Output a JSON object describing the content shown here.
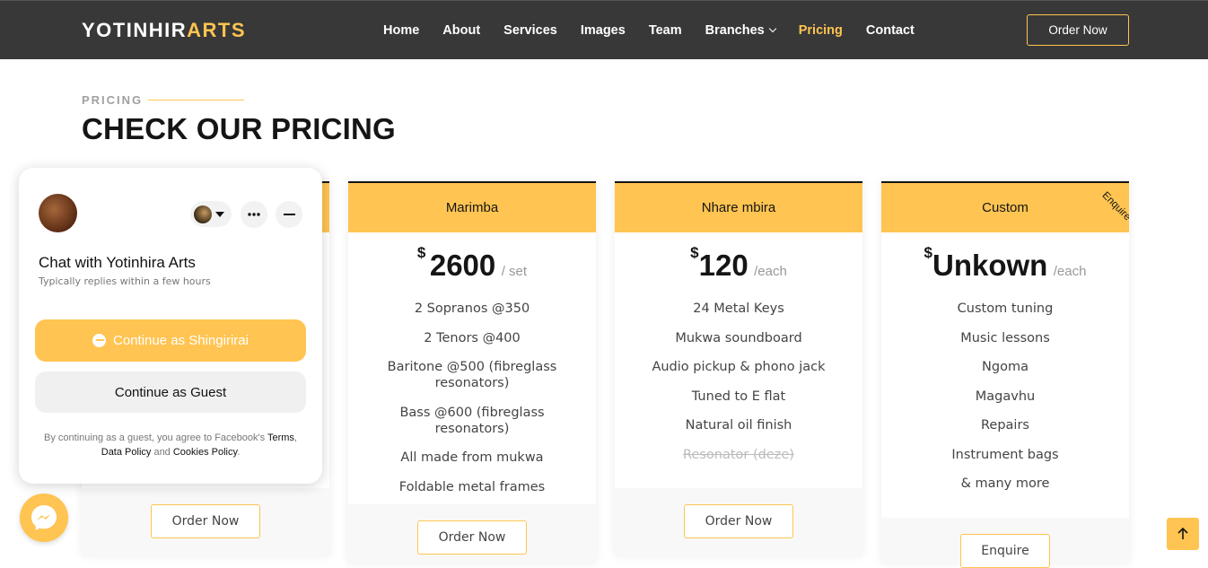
{
  "header": {
    "logo_main": "YOTINHIR",
    "logo_accent": "ARTS",
    "nav": [
      {
        "label": "Home"
      },
      {
        "label": "About"
      },
      {
        "label": "Services"
      },
      {
        "label": "Images"
      },
      {
        "label": "Team"
      },
      {
        "label": "Branches"
      },
      {
        "label": "Pricing"
      },
      {
        "label": "Contact"
      }
    ],
    "active_nav": "Pricing",
    "order_label": "Order Now"
  },
  "section": {
    "label": "PRICING",
    "title": "CHECK OUR PRICING"
  },
  "cards": [
    {
      "name": "",
      "button": "Order Now"
    },
    {
      "name": "Marimba",
      "currency": "$",
      "price": "2600",
      "unit": "/ set",
      "features": [
        "2 Sopranos @350",
        "2 Tenors @400",
        "Baritone @500 (fibreglass resonators)",
        "Bass @600 (fibreglass resonators)",
        "All made from mukwa",
        "Foldable metal frames"
      ],
      "button": "Order Now"
    },
    {
      "name": "Nhare mbira",
      "currency": "$",
      "price": "120",
      "unit": "/each",
      "features": [
        "24 Metal Keys",
        "Mukwa soundboard",
        "Audio pickup & phono jack",
        "Tuned to E flat",
        "Natural oil finish"
      ],
      "unavailable": "Resonator (deze)",
      "button": "Order Now"
    },
    {
      "name": "Custom",
      "ribbon": "Enquire",
      "currency": "$",
      "price": "Unkown",
      "unit": "/each",
      "features": [
        "Custom tuning",
        "Music lessons",
        "Ngoma",
        "Magavhu",
        "Repairs",
        "Instrument bags",
        "& many more"
      ],
      "button": "Enquire"
    }
  ],
  "chat": {
    "title": "Chat with Yotinhira Arts",
    "subtitle": "Typically replies within a few hours",
    "primary_label": "Continue as Shingirirai",
    "guest_label": "Continue as Guest",
    "legal_prefix": "By continuing as a guest, you agree to Facebook's ",
    "terms": "Terms",
    "data_policy": "Data Policy",
    "and": " and ",
    "cookies": "Cookies Policy",
    "comma": ",",
    "period": "."
  },
  "colors": {
    "accent": "#ffc451",
    "header_bg": "#383838",
    "dark": "#151515"
  }
}
